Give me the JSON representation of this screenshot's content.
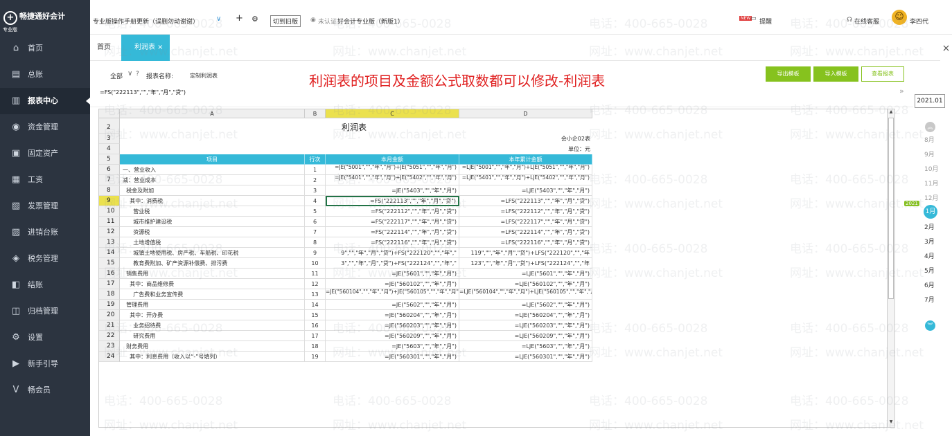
{
  "sidebar": {
    "logo_text": "畅捷通好会计",
    "edition": "专业版",
    "items": [
      {
        "label": "首页",
        "icon": "home-icon",
        "glyph": "⌂"
      },
      {
        "label": "总账",
        "icon": "ledger-icon",
        "glyph": "▤"
      },
      {
        "label": "报表中心",
        "icon": "report-icon",
        "glyph": "▥"
      },
      {
        "label": "资金管理",
        "icon": "fund-icon",
        "glyph": "◉"
      },
      {
        "label": "固定资产",
        "icon": "asset-icon",
        "glyph": "▣"
      },
      {
        "label": "工资",
        "icon": "salary-icon",
        "glyph": "▦"
      },
      {
        "label": "发票管理",
        "icon": "invoice-icon",
        "glyph": "▧"
      },
      {
        "label": "进销台账",
        "icon": "stock-icon",
        "glyph": "▨"
      },
      {
        "label": "税务管理",
        "icon": "tax-icon",
        "glyph": "◈"
      },
      {
        "label": "结账",
        "icon": "close-account-icon",
        "glyph": "◧"
      },
      {
        "label": "归档管理",
        "icon": "archive-icon",
        "glyph": "◫"
      },
      {
        "label": "设置",
        "icon": "gear-icon",
        "glyph": "⚙"
      },
      {
        "label": "新手引导",
        "icon": "guide-icon",
        "glyph": "▶"
      },
      {
        "label": "畅会员",
        "icon": "member-icon",
        "glyph": "V"
      }
    ]
  },
  "topbar": {
    "notice": "专业版操作手册更新（误删勿动谢谢）",
    "add": "+",
    "settings_glyph": "⚙",
    "old_version": "切到旧版",
    "unverified": "未认证",
    "company": "好会计专业版（新版1）",
    "new_badge": "NEW",
    "remind": "提醒",
    "service": "在线客服",
    "user": "李四代"
  },
  "tabs": {
    "home": "首页",
    "profit": "利润表 ×"
  },
  "toolbar": {
    "all": "全部",
    "report_name_label": "报表名称:",
    "report_name": "定制利润表",
    "export": "导出模板",
    "import": "导入模板",
    "view": "查看报表"
  },
  "banner": "利润表的项目及金额公式取数都可以修改-利润表",
  "formula_bar": "=FS(\"222113\",\"\",\"年\",\"月\",\"贷\")",
  "period": "2021.01",
  "months": {
    "items": [
      "8月",
      "9月",
      "10月",
      "11月",
      "12月",
      "1月",
      "2月",
      "3月",
      "4月",
      "5月",
      "6月",
      "7月"
    ],
    "current_index": 5,
    "year_badge": "2021"
  },
  "sheet": {
    "columns": [
      "A",
      "B",
      "C",
      "D"
    ],
    "selected_column": 2,
    "title": "利润表",
    "form_no": "会小企02表",
    "unit": "单位：元",
    "header": {
      "item": "项目",
      "line": "行次",
      "month": "本月金额",
      "year": "本年累计金额"
    },
    "selected_row": 9,
    "rows": [
      {
        "n": "6",
        "a": "一、营业收入",
        "b": "1",
        "c": "=JE(\"5001\",\"\",\"年\",\"月\")+JE(\"5051\",\"\",\"年\",\"月\")",
        "d": "=LJE(\"5001\",\"\",\"年\",\"月\")+LJE(\"5051\",\"\",\"年\",\"月\")"
      },
      {
        "n": "7",
        "a": "减：营业成本",
        "b": "2",
        "c": "=JE(\"5401\",\"\",\"年\",\"月\")+JE(\"5402\",\"\",\"年\",\"月\")",
        "d": "=LJE(\"5401\",\"\",\"年\",\"月\")+LJE(\"5402\",\"\",\"年\",\"月\")"
      },
      {
        "n": "8",
        "a": "  税金及附加",
        "b": "3",
        "c": "=JE(\"5403\",\"\",\"年\",\"月\")",
        "d": "=LJE(\"5403\",\"\",\"年\",\"月\")"
      },
      {
        "n": "9",
        "a": "    其中：消费税",
        "b": "4",
        "c": "=FS(\"222113\",\"\",\"年\",\"月\",\"贷\")",
        "d": "=LFS(\"222113\",\"\",\"年\",\"月\",\"贷\")"
      },
      {
        "n": "10",
        "a": "      营业税",
        "b": "5",
        "c": "=FS(\"222112\",\"\",\"年\",\"月\",\"贷\")",
        "d": "=LFS(\"222112\",\"\",\"年\",\"月\",\"贷\")"
      },
      {
        "n": "11",
        "a": "      城市维护建设税",
        "b": "6",
        "c": "=FS(\"222117\",\"\",\"年\",\"月\",\"贷\")",
        "d": "=LFS(\"222117\",\"\",\"年\",\"月\",\"贷\")"
      },
      {
        "n": "12",
        "a": "      资源税",
        "b": "7",
        "c": "=FS(\"222114\",\"\",\"年\",\"月\",\"贷\")",
        "d": "=LFS(\"222114\",\"\",\"年\",\"月\",\"贷\")"
      },
      {
        "n": "13",
        "a": "      土地增值税",
        "b": "8",
        "c": "=FS(\"222116\",\"\",\"年\",\"月\",\"贷\")",
        "d": "=LFS(\"222116\",\"\",\"年\",\"月\",\"贷\")"
      },
      {
        "n": "14",
        "a": "      城镇土地使用税、房产税、车船税、印花税",
        "b": "9",
        "c": "9\",\"\",\"年\",\"月\",\"贷\")+FS(\"222120\",\"\",\"年\",\"",
        "d": "119\",\"\",\"年\",\"月\",\"贷\")+LFS(\"222120\",\"\",\"年"
      },
      {
        "n": "15",
        "a": "      教育费附加、矿产资源补偿费、排污费",
        "b": "10",
        "c": "3\",\"\",\"年\",\"月\",\"贷\")+FS(\"222124\",\"\",\"年\",\"",
        "d": "123\",\"\",\"年\",\"月\",\"贷\")+LFS(\"222124\",\"\",\"年"
      },
      {
        "n": "16",
        "a": "  销售费用",
        "b": "11",
        "c": "=JE(\"5601\",\"\",\"年\",\"月\")",
        "d": "=LJE(\"5601\",\"\",\"年\",\"月\")"
      },
      {
        "n": "17",
        "a": "    其中：商品维修费",
        "b": "12",
        "c": "=JE(\"560102\",\"\",\"年\",\"月\")",
        "d": "=LJE(\"560102\",\"\",\"年\",\"月\")"
      },
      {
        "n": "18",
        "a": "      广告费和业务宣传费",
        "b": "13",
        "c": "=JE(\"560104\",\"\",\"年\",\"月\")+JE(\"560105\",\"\",\"年\",\"月\")",
        "d": "=LJE(\"560104\",\"\",\"年\",\"月\")+LJE(\"560105\",\"\",\"年\",\"月\")"
      },
      {
        "n": "19",
        "a": "  管理费用",
        "b": "14",
        "c": "=JE(\"5602\",\"\",\"年\",\"月\")",
        "d": "=LJE(\"5602\",\"\",\"年\",\"月\")"
      },
      {
        "n": "20",
        "a": "    其中：开办费",
        "b": "15",
        "c": "=JE(\"560204\",\"\",\"年\",\"月\")",
        "d": "=LJE(\"560204\",\"\",\"年\",\"月\")"
      },
      {
        "n": "21",
        "a": "      业务招待费",
        "b": "16",
        "c": "=JE(\"560203\",\"\",\"年\",\"月\")",
        "d": "=LJE(\"560203\",\"\",\"年\",\"月\")"
      },
      {
        "n": "22",
        "a": "      研究费用",
        "b": "17",
        "c": "=JE(\"560209\",\"\",\"年\",\"月\")",
        "d": "=LJE(\"560209\",\"\",\"年\",\"月\")"
      },
      {
        "n": "23",
        "a": "  财务费用",
        "b": "18",
        "c": "=JE(\"5603\",\"\",\"年\",\"月\")",
        "d": "=LJE(\"5603\",\"\",\"年\",\"月\")"
      },
      {
        "n": "24",
        "a": "    其中：利息费用（收入以“-”号填列）",
        "b": "19",
        "c": "=JE(\"560301\",\"\",\"年\",\"月\")",
        "d": "=LJE(\"560301\",\"\",\"年\",\"月\")"
      }
    ]
  },
  "watermarks": {
    "phone": "电话：400-665-0028",
    "web": "网址：www.chanjet.net"
  },
  "colors": {
    "sidebar": "#2c3440",
    "accent": "#35b9d8",
    "green": "#86c21e",
    "banner": "#e02020",
    "select": "#ebe14e"
  }
}
